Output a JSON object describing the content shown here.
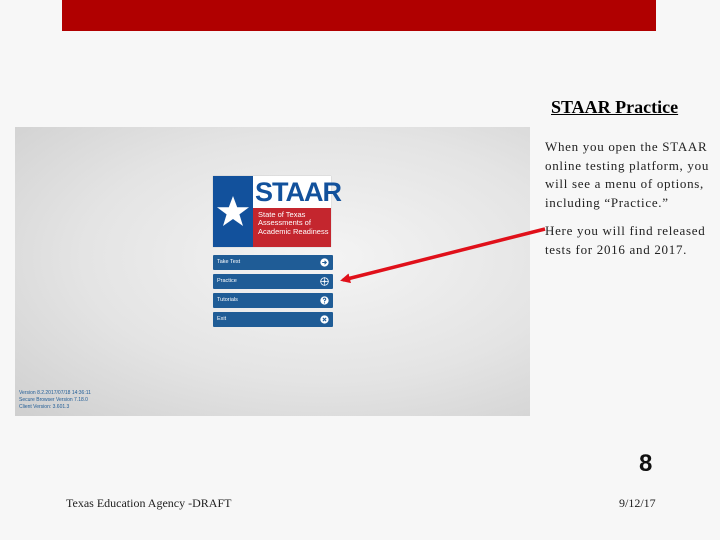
{
  "slide": {
    "title": "STAAR Practice",
    "body_paragraphs": [
      "When you open the STAAR online testing platform, you will see a menu of options, including “Practice.”",
      "Here you will find released tests for 2016 and 2017."
    ],
    "slide_number": "8",
    "footer_left": "Texas Education Agency -DRAFT",
    "footer_right": "9/12/17",
    "colors": {
      "banner": "#b00000",
      "arrow": "#e0101a"
    }
  },
  "app": {
    "logo": {
      "wordmark": "STAAR",
      "subtitle_lines": [
        "State of Texas",
        "Assessments of",
        "Academic Readiness"
      ],
      "colors": {
        "blue": "#12519c",
        "red": "#c4262e"
      }
    },
    "menu": [
      {
        "label": "Take Test",
        "icon": "arrow-right-circle-icon"
      },
      {
        "label": "Practice",
        "icon": "compass-icon"
      },
      {
        "label": "Tutorials",
        "icon": "help-circle-icon"
      },
      {
        "label": "Exit",
        "icon": "close-circle-icon"
      }
    ],
    "version_lines": [
      "Version 8.2.2017/07/18 14:36:11",
      "Secure Browser Version 7.18.0",
      "Client Version: 3.601.3"
    ]
  }
}
